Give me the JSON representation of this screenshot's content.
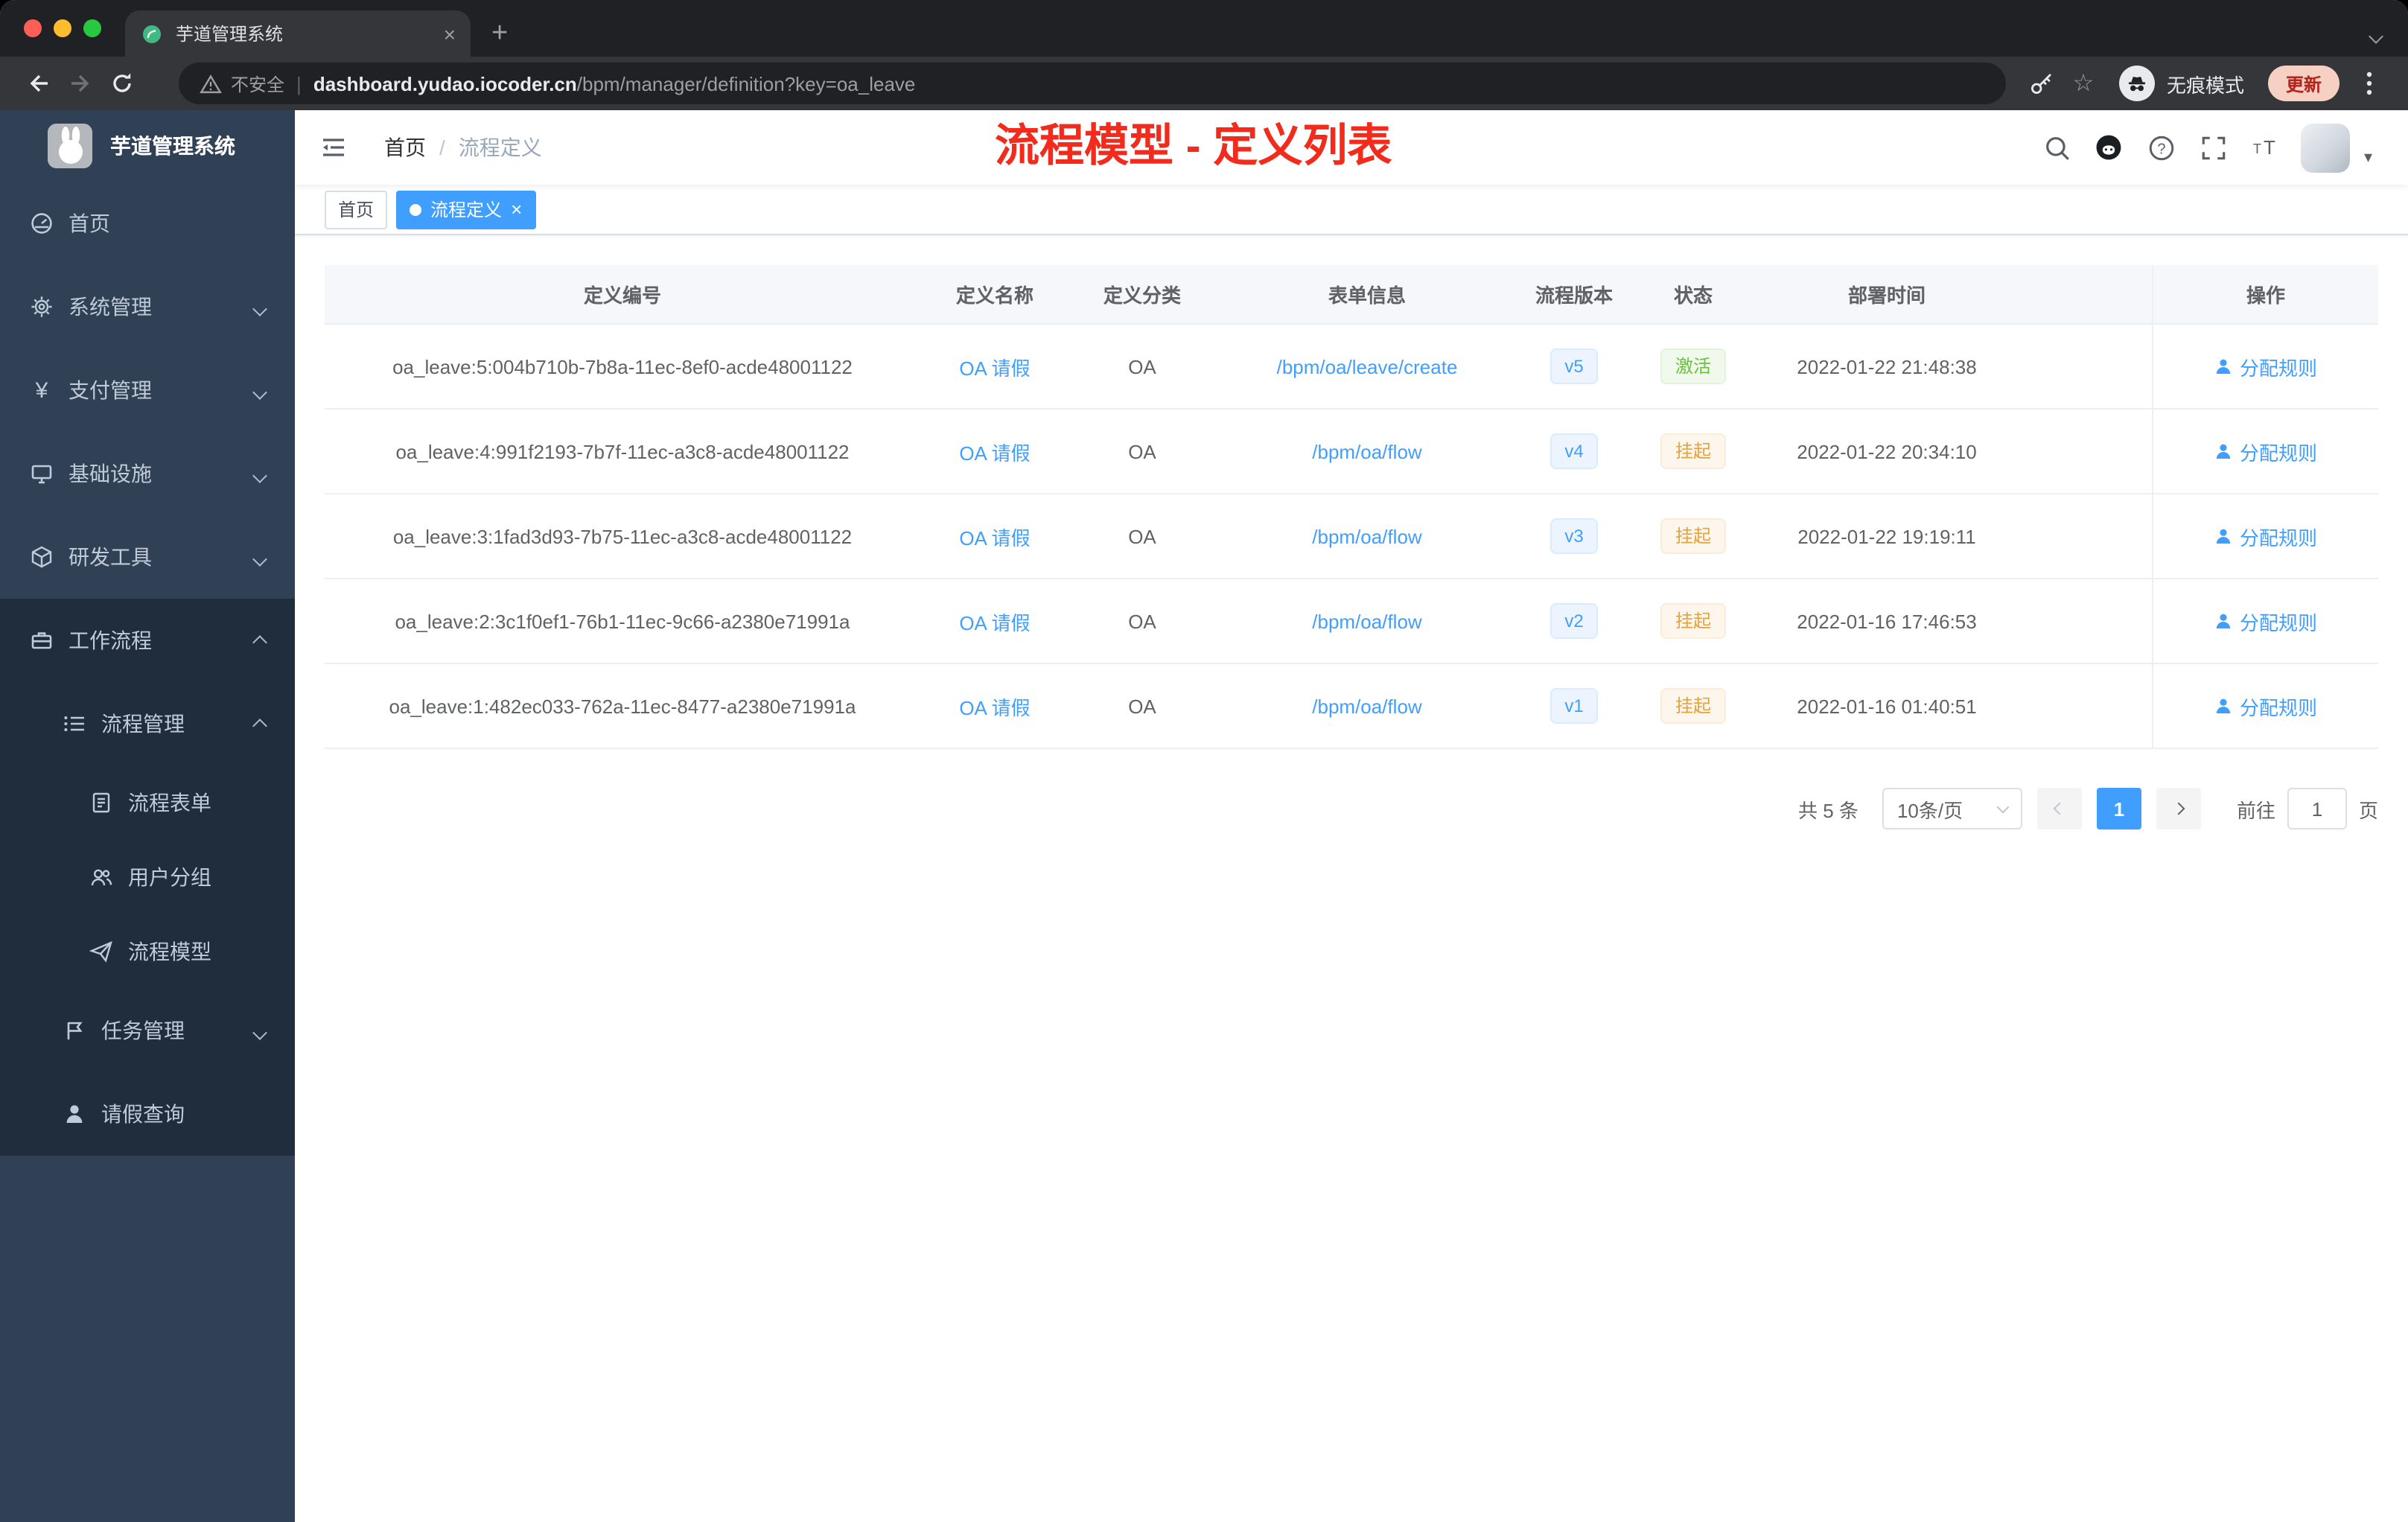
{
  "browser": {
    "tab_title": "芋道管理系统",
    "tab_close": "×",
    "new_tab": "+",
    "security_label": "不安全",
    "url_host": "dashboard.yudao.iocoder.cn",
    "url_path": "/bpm/manager/definition?key=oa_leave",
    "star_glyph": "☆",
    "incognito_label": "无痕模式",
    "update_label": "更新"
  },
  "sidebar": {
    "logo_title": "芋道管理系统",
    "items": {
      "home": "首页",
      "system": "系统管理",
      "pay": "支付管理",
      "infra": "基础设施",
      "dev": "研发工具",
      "workflow": "工作流程",
      "process_mgmt": "流程管理",
      "process_form": "流程表单",
      "user_group": "用户分组",
      "process_model": "流程模型",
      "task_mgmt": "任务管理",
      "leave_query": "请假查询"
    }
  },
  "header": {
    "breadcrumb_home": "首页",
    "breadcrumb_sep": "/",
    "breadcrumb_current": "流程定义",
    "annotation": "流程模型 - 定义列表"
  },
  "tags": {
    "home": "首页",
    "active": "流程定义",
    "close": "×"
  },
  "table": {
    "columns": [
      "定义编号",
      "定义名称",
      "定义分类",
      "表单信息",
      "流程版本",
      "状态",
      "部署时间",
      "操作"
    ],
    "action_label": "分配规则",
    "rows": [
      {
        "id": "oa_leave:5:004b710b-7b8a-11ec-8ef0-acde48001122",
        "name": "OA 请假",
        "category": "OA",
        "form": "/bpm/oa/leave/create",
        "version": "v5",
        "status": "激活",
        "status_type": "success",
        "deploy_time": "2022-01-22 21:48:38"
      },
      {
        "id": "oa_leave:4:991f2193-7b7f-11ec-a3c8-acde48001122",
        "name": "OA 请假",
        "category": "OA",
        "form": "/bpm/oa/flow",
        "version": "v4",
        "status": "挂起",
        "status_type": "warning",
        "deploy_time": "2022-01-22 20:34:10"
      },
      {
        "id": "oa_leave:3:1fad3d93-7b75-11ec-a3c8-acde48001122",
        "name": "OA 请假",
        "category": "OA",
        "form": "/bpm/oa/flow",
        "version": "v3",
        "status": "挂起",
        "status_type": "warning",
        "deploy_time": "2022-01-22 19:19:11"
      },
      {
        "id": "oa_leave:2:3c1f0ef1-76b1-11ec-9c66-a2380e71991a",
        "name": "OA 请假",
        "category": "OA",
        "form": "/bpm/oa/flow",
        "version": "v2",
        "status": "挂起",
        "status_type": "warning",
        "deploy_time": "2022-01-16 17:46:53"
      },
      {
        "id": "oa_leave:1:482ec033-762a-11ec-8477-a2380e71991a",
        "name": "OA 请假",
        "category": "OA",
        "form": "/bpm/oa/flow",
        "version": "v1",
        "status": "挂起",
        "status_type": "warning",
        "deploy_time": "2022-01-16 01:40:51"
      }
    ]
  },
  "pagination": {
    "total": "共 5 条",
    "page_size": "10条/页",
    "current_page": "1",
    "goto_label": "前往",
    "goto_value": "1",
    "page_unit": "页"
  },
  "colors": {
    "accent": "#409eff",
    "sidebar_bg": "#304156",
    "submenu_bg": "#1f2d3d",
    "annotation": "#f22b1d",
    "success": "#67c23a",
    "warning": "#e6a23c"
  }
}
